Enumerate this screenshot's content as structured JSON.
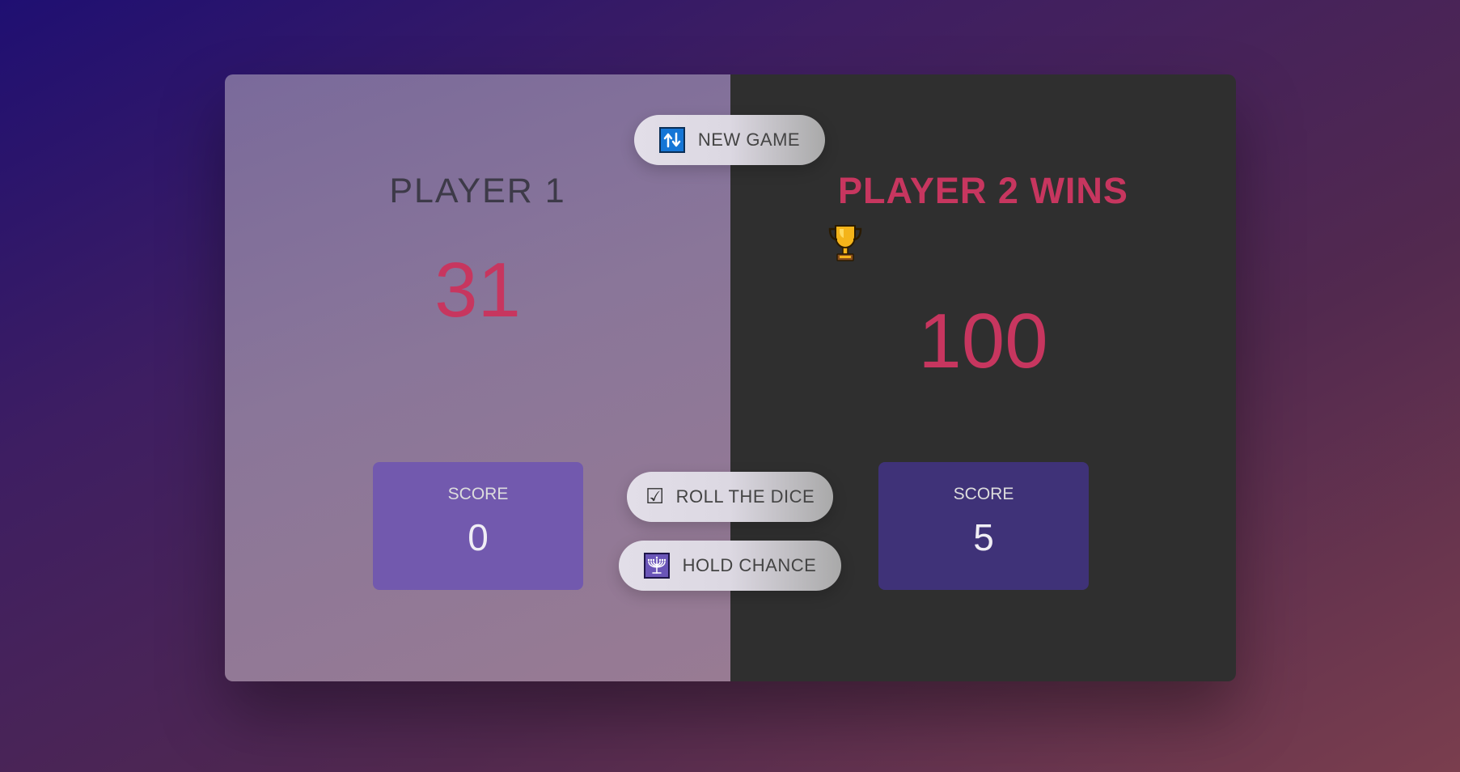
{
  "players": [
    {
      "name": "PLAYER 1",
      "total_score": "31",
      "current_label": "SCORE",
      "current_score": "0"
    },
    {
      "name": "PLAYER 2 WINS",
      "winner_icon": "trophy-icon",
      "total_score": "100",
      "current_label": "SCORE",
      "current_score": "5"
    }
  ],
  "buttons": {
    "new_game": {
      "label": "NEW GAME",
      "icon": "refresh-icon"
    },
    "roll": {
      "label": "ROLL THE DICE",
      "icon": "checkbox-icon"
    },
    "hold": {
      "label": "HOLD CHANCE",
      "icon": "menorah-icon"
    }
  },
  "colors": {
    "accent": "#c7365f",
    "player1_bg": "#8a7699",
    "player2_bg": "#2f2f2f",
    "player1_current": "#7259ae",
    "player2_current": "#3f3278"
  }
}
